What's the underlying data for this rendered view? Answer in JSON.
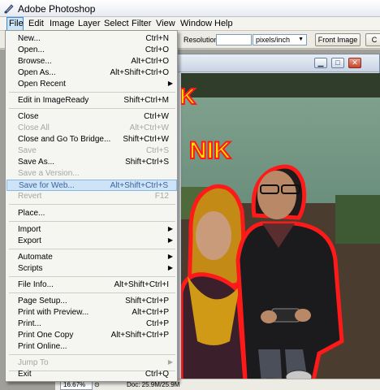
{
  "window": {
    "title": "Adobe Photoshop"
  },
  "menubar": {
    "items": [
      "File",
      "Edit",
      "Image",
      "Layer",
      "Select",
      "Filter",
      "View",
      "Window",
      "Help"
    ]
  },
  "options": {
    "resolution_label": "Resolution:",
    "resolution_value": "",
    "unit_value": "pixels/inch",
    "front_image_label": "Front Image",
    "clear_label": "C"
  },
  "file_menu": {
    "items": [
      {
        "label": "New...",
        "shortcut": "Ctrl+N"
      },
      {
        "label": "Open...",
        "shortcut": "Ctrl+O"
      },
      {
        "label": "Browse...",
        "shortcut": "Alt+Ctrl+O"
      },
      {
        "label": "Open As...",
        "shortcut": "Alt+Shift+Ctrl+O"
      },
      {
        "label": "Open Recent",
        "shortcut": ""
      },
      {
        "label": "Edit in ImageReady",
        "shortcut": "Shift+Ctrl+M"
      },
      {
        "label": "Close",
        "shortcut": "Ctrl+W"
      },
      {
        "label": "Close All",
        "shortcut": "Alt+Ctrl+W"
      },
      {
        "label": "Close and Go To Bridge...",
        "shortcut": "Shift+Ctrl+W"
      },
      {
        "label": "Save",
        "shortcut": "Ctrl+S"
      },
      {
        "label": "Save As...",
        "shortcut": "Shift+Ctrl+S"
      },
      {
        "label": "Save a Version...",
        "shortcut": ""
      },
      {
        "label": "Save for Web...",
        "shortcut": "Alt+Shift+Ctrl+S"
      },
      {
        "label": "Revert",
        "shortcut": "F12"
      },
      {
        "label": "Place...",
        "shortcut": ""
      },
      {
        "label": "Import",
        "shortcut": ""
      },
      {
        "label": "Export",
        "shortcut": ""
      },
      {
        "label": "Automate",
        "shortcut": ""
      },
      {
        "label": "Scripts",
        "shortcut": ""
      },
      {
        "label": "File Info...",
        "shortcut": "Alt+Shift+Ctrl+I"
      },
      {
        "label": "Page Setup...",
        "shortcut": "Shift+Ctrl+P"
      },
      {
        "label": "Print with Preview...",
        "shortcut": "Alt+Ctrl+P"
      },
      {
        "label": "Print...",
        "shortcut": "Ctrl+P"
      },
      {
        "label": "Print One Copy",
        "shortcut": "Alt+Shift+Ctrl+P"
      },
      {
        "label": "Print Online...",
        "shortcut": ""
      },
      {
        "label": "Jump To",
        "shortcut": ""
      },
      {
        "label": "Exit",
        "shortcut": "Ctrl+Q"
      }
    ]
  },
  "canvas": {
    "overlay_text_top": "K",
    "overlay_text_mid": "NIK",
    "overlay_color": "#f5e400",
    "outline_color": "#ff1a1a"
  },
  "status": {
    "zoom": "16.67%",
    "doc_info": "Doc: 25.9M/25.9M"
  },
  "colors": {
    "menu_highlight": "#cde4f7",
    "accent": "#3a88d8"
  }
}
